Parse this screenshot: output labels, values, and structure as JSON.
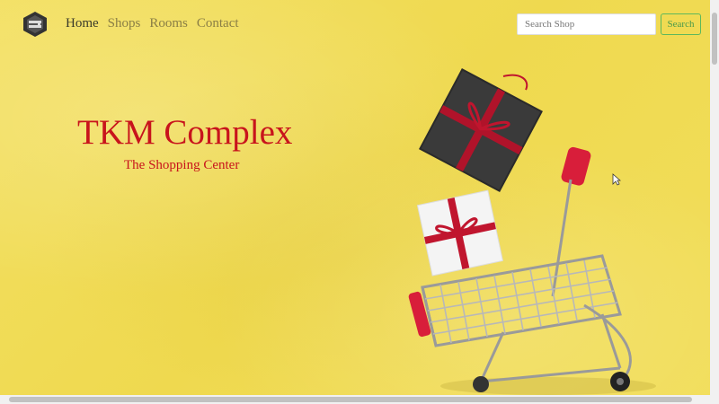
{
  "nav": {
    "logo": "site-logo-icon",
    "links": [
      "Home",
      "Shops",
      "Rooms",
      "Contact"
    ],
    "active": "Home"
  },
  "search": {
    "placeholder": "Search Shop",
    "value": "",
    "button_label": "Search"
  },
  "hero": {
    "title": "TKM Complex",
    "subtitle": "The Shopping Center",
    "image": "shopping-cart-with-gift-boxes"
  },
  "colors": {
    "background": "#f0dd55",
    "title": "#c8141c",
    "active_link": "#3a3a2a",
    "inactive_link": "#8a7e45",
    "search_button_border": "#5cb85c"
  }
}
